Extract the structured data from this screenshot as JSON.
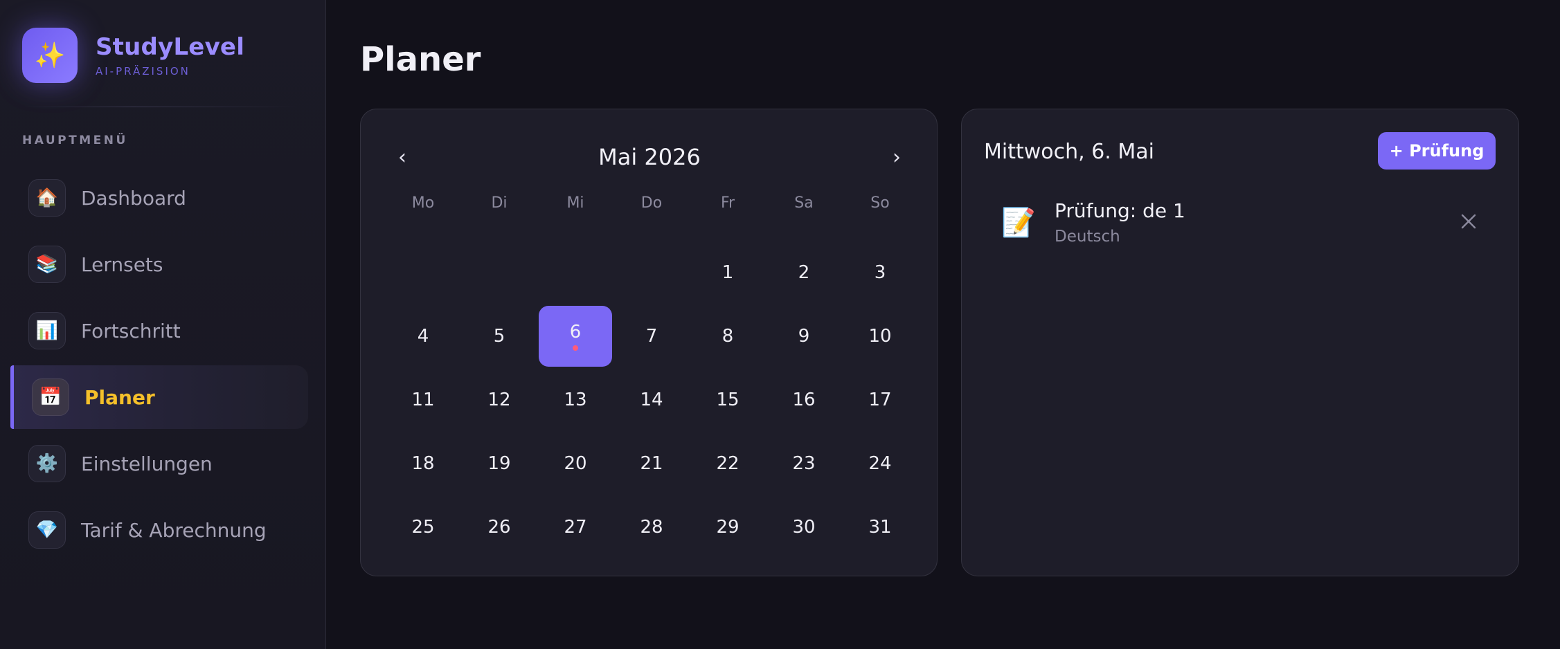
{
  "brand": {
    "name": "StudyLevel",
    "subtitle": "AI-PRÄZISION",
    "logo_icon": "✨"
  },
  "sidebar": {
    "section_label": "HAUPTMENÜ",
    "items": [
      {
        "label": "Dashboard",
        "icon": "🏠",
        "icon_name": "house-icon",
        "active": false
      },
      {
        "label": "Lernsets",
        "icon": "📚",
        "icon_name": "books-icon",
        "active": false
      },
      {
        "label": "Fortschritt",
        "icon": "📊",
        "icon_name": "bar-chart-icon",
        "active": false
      },
      {
        "label": "Planer",
        "icon": "📅",
        "icon_name": "calendar-icon",
        "active": true
      },
      {
        "label": "Einstellungen",
        "icon": "⚙️",
        "icon_name": "gear-icon",
        "active": false
      },
      {
        "label": "Tarif & Abrechnung",
        "icon": "💎",
        "icon_name": "gem-icon",
        "active": false
      }
    ]
  },
  "page": {
    "title": "Planer"
  },
  "calendar": {
    "month_label": "Mai 2026",
    "prev_symbol": "‹",
    "next_symbol": "›",
    "weekdays": [
      "Mo",
      "Di",
      "Mi",
      "Do",
      "Fr",
      "Sa",
      "So"
    ],
    "leading_blanks": 4,
    "days_in_month": 31,
    "selected_day": 6,
    "days_with_events": [
      6
    ]
  },
  "detail": {
    "date_label": "Mittwoch, 6. Mai",
    "add_button_label": "+ Prüfung",
    "events": [
      {
        "title": "Prüfung: de 1",
        "subject": "Deutsch",
        "icon": "📝"
      }
    ]
  },
  "colors": {
    "accent": "#7b68f5",
    "active_nav_text": "#f5c02a",
    "event_dot": "#ff5b7a",
    "background": "#12111a",
    "card": "#1e1d29"
  }
}
